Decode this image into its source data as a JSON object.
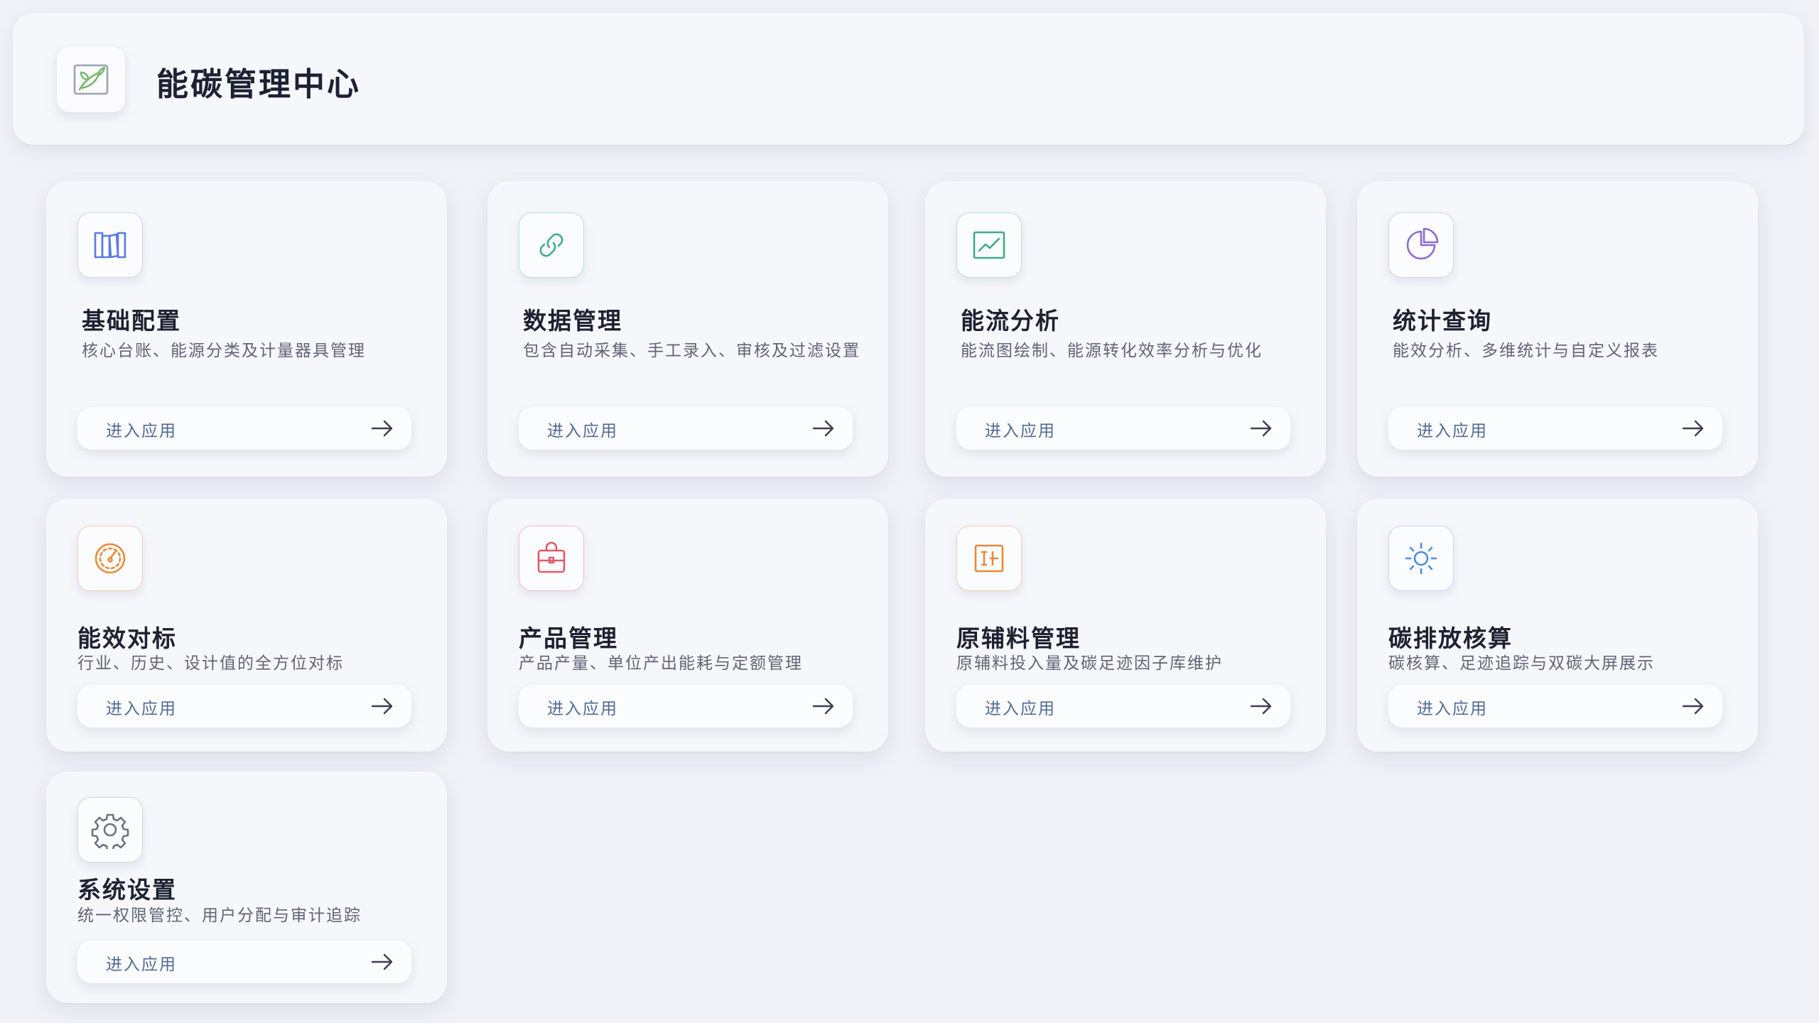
{
  "app": {
    "title": "能碳管理中心",
    "logo_icon": "leaf-image-icon"
  },
  "enter_label": "进入应用",
  "colors": {
    "background": "#f0f2f7",
    "card": "#f6f7fb",
    "button_text": "#506a90"
  },
  "modules": [
    {
      "title": "基础配置",
      "description": "核心台账、能源分类及计量器具管理",
      "icon": "book-shelf-icon",
      "color": "#5b7be0",
      "button": "进入应用"
    },
    {
      "title": "数据管理",
      "description": "包含自动采集、手工录入、审核及过滤设置",
      "icon": "link-icon",
      "color": "#3fae84",
      "button": "进入应用"
    },
    {
      "title": "能流分析",
      "description": "能流图绘制、能源转化效率分析与优化",
      "icon": "trend-chart-icon",
      "color": "#3fae84",
      "button": "进入应用"
    },
    {
      "title": "统计查询",
      "description": "能效分析、多维统计与自定义报表",
      "icon": "pie-chart-icon",
      "color": "#8c6bd6",
      "button": "进入应用"
    },
    {
      "title": "能效对标",
      "description": "行业、历史、设计值的全方位对标",
      "icon": "gauge-icon",
      "color": "#e98a3a",
      "button": "进入应用"
    },
    {
      "title": "产品管理",
      "description": "产品产量、单位产出能耗与定额管理",
      "icon": "shopping-bag-icon",
      "color": "#e05a6a",
      "button": "进入应用"
    },
    {
      "title": "原辅料管理",
      "description": "原辅料投入量及碳足迹因子库维护",
      "icon": "material-box-icon",
      "color": "#e98a3a",
      "button": "进入应用"
    },
    {
      "title": "碳排放核算",
      "description": "碳核算、足迹追踪与双碳大屏展示",
      "icon": "sun-icon",
      "color": "#4f8be0",
      "button": "进入应用"
    },
    {
      "title": "系统设置",
      "description": "统一权限管控、用户分配与审计追踪",
      "icon": "gear-icon",
      "color": "#6b7383",
      "button": "进入应用"
    }
  ]
}
